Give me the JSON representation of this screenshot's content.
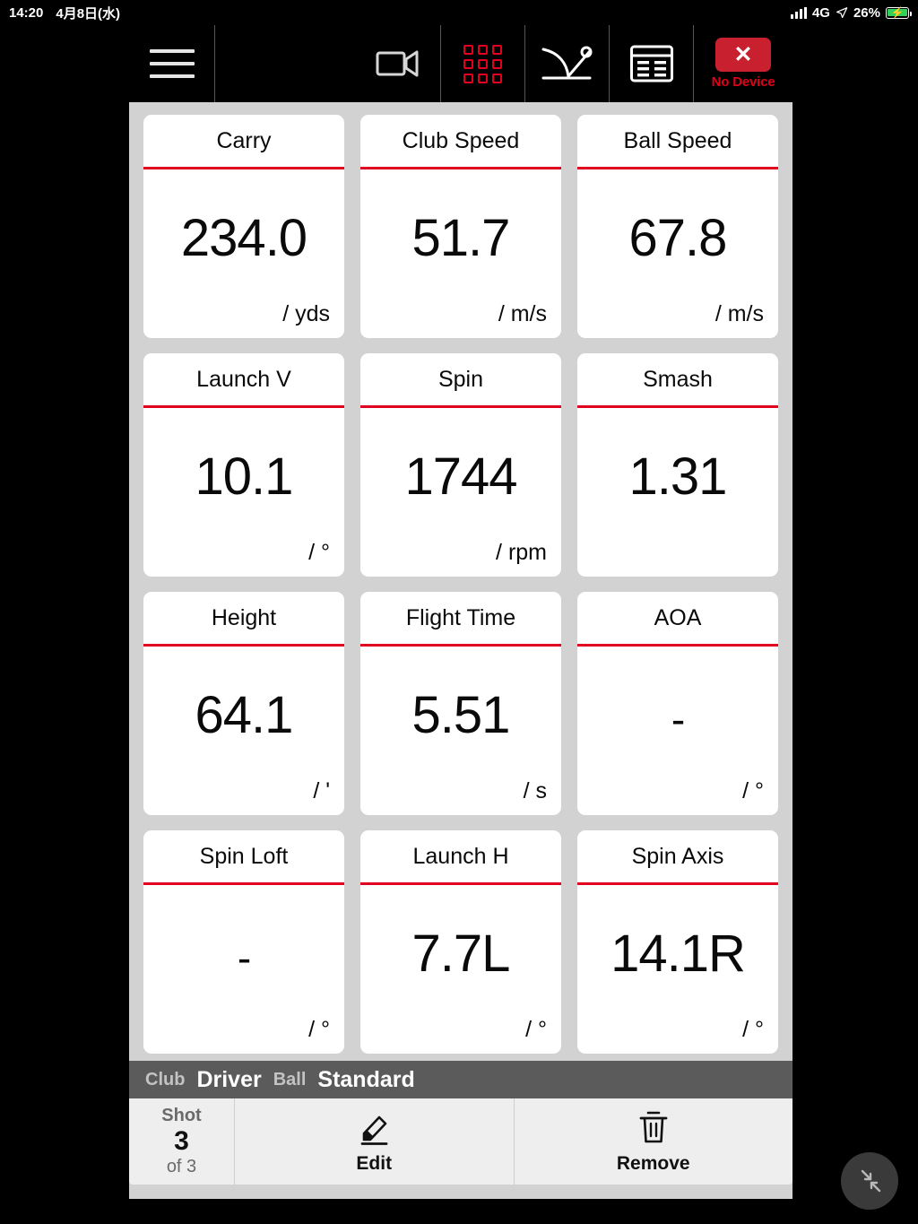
{
  "status_bar": {
    "time": "14:20",
    "date": "4月8日(水)",
    "network": "4G",
    "battery_percent": "26%",
    "location_icon": "location-arrow-icon",
    "battery_color": "#31d158"
  },
  "toolbar": {
    "menu_icon": "hamburger-menu-icon",
    "video_icon": "video-camera-icon",
    "grid_icon": "grid-3x3-icon",
    "trajectory_icon": "launch-angle-icon",
    "table_icon": "data-table-icon",
    "device_button_glyph": "✕",
    "device_status": "No Device",
    "accent_red": "#e00020",
    "device_button_bg": "#c8202f"
  },
  "metrics": [
    {
      "title": "Carry",
      "value": "234.0",
      "unit": "/ yds"
    },
    {
      "title": "Club Speed",
      "value": "51.7",
      "unit": "/ m/s"
    },
    {
      "title": "Ball Speed",
      "value": "67.8",
      "unit": "/ m/s"
    },
    {
      "title": "Launch V",
      "value": "10.1",
      "unit": "/ °"
    },
    {
      "title": "Spin",
      "value": "1744",
      "unit": "/ rpm"
    },
    {
      "title": "Smash",
      "value": "1.31",
      "unit": ""
    },
    {
      "title": "Height",
      "value": "64.1",
      "unit": "/ '"
    },
    {
      "title": "Flight Time",
      "value": "5.51",
      "unit": "/ s"
    },
    {
      "title": "AOA",
      "value": "-",
      "unit": "/ °"
    },
    {
      "title": "Spin Loft",
      "value": "-",
      "unit": "/ °"
    },
    {
      "title": "Launch H",
      "value": "7.7L",
      "unit": "/ °"
    },
    {
      "title": "Spin Axis",
      "value": "14.1R",
      "unit": "/ °"
    }
  ],
  "club_bar": {
    "club_label": "Club",
    "club_value": "Driver",
    "ball_label": "Ball",
    "ball_value": "Standard"
  },
  "footer": {
    "shot_label": "Shot",
    "shot_number": "3",
    "shot_of": "of 3",
    "edit_label": "Edit",
    "edit_icon": "pencil-edit-icon",
    "remove_label": "Remove",
    "remove_icon": "trash-icon"
  },
  "fab": {
    "icon": "collapse-arrows-icon"
  }
}
